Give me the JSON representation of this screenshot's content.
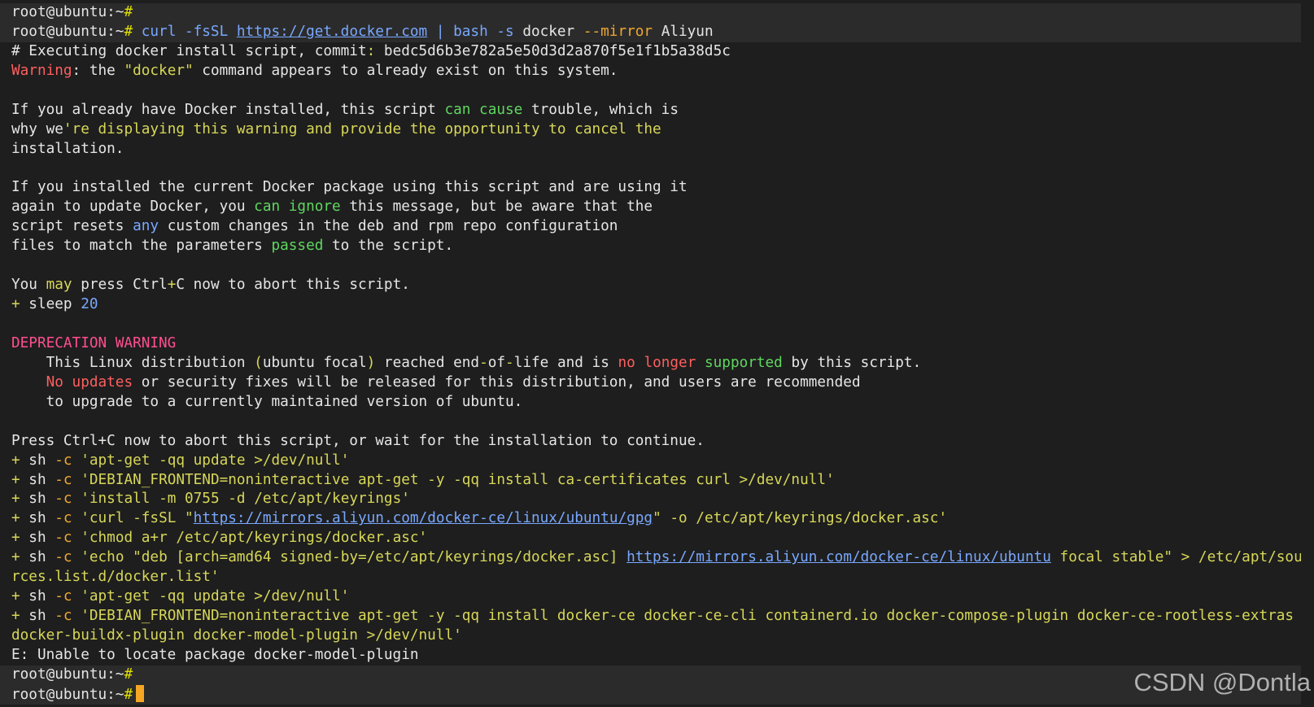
{
  "colors": {
    "default": "#e6e6e6",
    "prompt_hash": "#e0e000",
    "yellow": "#d7d759",
    "blue": "#79a8ff",
    "red": "#ff5f5f",
    "orange": "#f0a830",
    "green": "#5fd75f",
    "magenta": "#ff4f8f",
    "cursor": "#f5a623"
  },
  "watermark": "CSDN @Dontla",
  "lines": [
    {
      "hl": true,
      "segs": [
        {
          "t": "root@ubuntu:~",
          "c": "default"
        },
        {
          "t": "#",
          "c": "prompt_hash"
        }
      ]
    },
    {
      "hl": true,
      "segs": [
        {
          "t": "root@ubuntu:~",
          "c": "default"
        },
        {
          "t": "#",
          "c": "prompt_hash"
        },
        {
          "t": " curl -fsSL ",
          "c": "blue"
        },
        {
          "t": "https://get.docker.com",
          "c": "blue",
          "u": true
        },
        {
          "t": " | bash -s ",
          "c": "blue"
        },
        {
          "t": "docker ",
          "c": "default"
        },
        {
          "t": "--mirror",
          "c": "orange"
        },
        {
          "t": " Aliyun",
          "c": "default"
        }
      ]
    },
    {
      "segs": [
        {
          "t": "# Executing docker install script, commit",
          "c": "default"
        },
        {
          "t": ":",
          "c": "yellow"
        },
        {
          "t": " bedc5d6b3e782a5e50d3d2a870f5e1f1b5a38d5c",
          "c": "default"
        }
      ]
    },
    {
      "segs": [
        {
          "t": "Warning",
          "c": "red"
        },
        {
          "t": ": the ",
          "c": "default"
        },
        {
          "t": "\"docker\"",
          "c": "yellow"
        },
        {
          "t": " command appears to already exist on this system.",
          "c": "default"
        }
      ]
    },
    {
      "segs": [
        {
          "t": "",
          "c": "default"
        }
      ]
    },
    {
      "segs": [
        {
          "t": "If you already have Docker installed, this script ",
          "c": "default"
        },
        {
          "t": "can cause",
          "c": "green"
        },
        {
          "t": " trouble, which is",
          "c": "default"
        }
      ]
    },
    {
      "segs": [
        {
          "t": "why we",
          "c": "default"
        },
        {
          "t": "'re displaying this warning and provide the opportunity to cancel the",
          "c": "yellow"
        }
      ]
    },
    {
      "segs": [
        {
          "t": "installation.",
          "c": "default"
        }
      ]
    },
    {
      "segs": [
        {
          "t": "",
          "c": "default"
        }
      ]
    },
    {
      "segs": [
        {
          "t": "If you installed the current Docker package using this script and are using it",
          "c": "default"
        }
      ]
    },
    {
      "segs": [
        {
          "t": "again to update Docker, you ",
          "c": "default"
        },
        {
          "t": "can ignore",
          "c": "green"
        },
        {
          "t": " this message, but be aware that the",
          "c": "default"
        }
      ]
    },
    {
      "segs": [
        {
          "t": "script resets ",
          "c": "default"
        },
        {
          "t": "any",
          "c": "blue"
        },
        {
          "t": " custom changes in the deb and rpm repo configuration",
          "c": "default"
        }
      ]
    },
    {
      "segs": [
        {
          "t": "files to match the parameters ",
          "c": "default"
        },
        {
          "t": "passed",
          "c": "green"
        },
        {
          "t": " to the script.",
          "c": "default"
        }
      ]
    },
    {
      "segs": [
        {
          "t": "",
          "c": "default"
        }
      ]
    },
    {
      "segs": [
        {
          "t": "You ",
          "c": "default"
        },
        {
          "t": "may",
          "c": "yellow"
        },
        {
          "t": " press Ctrl",
          "c": "default"
        },
        {
          "t": "+",
          "c": "yellow"
        },
        {
          "t": "C now to abort this script.",
          "c": "default"
        }
      ]
    },
    {
      "segs": [
        {
          "t": "+",
          "c": "yellow"
        },
        {
          "t": " sleep ",
          "c": "default"
        },
        {
          "t": "20",
          "c": "blue"
        }
      ]
    },
    {
      "segs": [
        {
          "t": "",
          "c": "default"
        }
      ]
    },
    {
      "segs": [
        {
          "t": "DEPRECATION WARNING",
          "c": "magenta"
        }
      ]
    },
    {
      "segs": [
        {
          "t": "    This Linux distribution ",
          "c": "default"
        },
        {
          "t": "(",
          "c": "yellow"
        },
        {
          "t": "ubuntu focal",
          "c": "default"
        },
        {
          "t": ")",
          "c": "yellow"
        },
        {
          "t": " reached end",
          "c": "default"
        },
        {
          "t": "-",
          "c": "yellow"
        },
        {
          "t": "of",
          "c": "default"
        },
        {
          "t": "-",
          "c": "yellow"
        },
        {
          "t": "life and is ",
          "c": "default"
        },
        {
          "t": "no longer",
          "c": "red"
        },
        {
          "t": " supported",
          "c": "green"
        },
        {
          "t": " by this script.",
          "c": "default"
        }
      ]
    },
    {
      "segs": [
        {
          "t": "    ",
          "c": "default"
        },
        {
          "t": "No updates",
          "c": "red"
        },
        {
          "t": " or security fixes will be released for this distribution, and users are recommended",
          "c": "default"
        }
      ]
    },
    {
      "segs": [
        {
          "t": "    to upgrade to a currently maintained version of ubuntu.",
          "c": "default"
        }
      ]
    },
    {
      "segs": [
        {
          "t": "",
          "c": "default"
        }
      ]
    },
    {
      "segs": [
        {
          "t": "Press Ctrl+C now to abort this script, or wait for the installation to continue.",
          "c": "default"
        }
      ]
    },
    {
      "segs": [
        {
          "t": "+",
          "c": "yellow"
        },
        {
          "t": " sh ",
          "c": "default"
        },
        {
          "t": "-c",
          "c": "orange"
        },
        {
          "t": " 'apt-get -qq update >/dev/null'",
          "c": "yellow"
        }
      ]
    },
    {
      "segs": [
        {
          "t": "+",
          "c": "yellow"
        },
        {
          "t": " sh ",
          "c": "default"
        },
        {
          "t": "-c",
          "c": "orange"
        },
        {
          "t": " 'DEBIAN_FRONTEND=noninteractive apt-get -y -qq install ca-certificates curl >/dev/null'",
          "c": "yellow"
        }
      ]
    },
    {
      "segs": [
        {
          "t": "+",
          "c": "yellow"
        },
        {
          "t": " sh ",
          "c": "default"
        },
        {
          "t": "-c",
          "c": "orange"
        },
        {
          "t": " 'install -m 0755 -d /etc/apt/keyrings'",
          "c": "yellow"
        }
      ]
    },
    {
      "segs": [
        {
          "t": "+",
          "c": "yellow"
        },
        {
          "t": " sh ",
          "c": "default"
        },
        {
          "t": "-c",
          "c": "orange"
        },
        {
          "t": " 'curl -fsSL \"",
          "c": "yellow"
        },
        {
          "t": "https://mirrors.aliyun.com/docker-ce/linux/ubuntu/gpg",
          "c": "blue",
          "u": true
        },
        {
          "t": "\" -o /etc/apt/keyrings/docker.asc'",
          "c": "yellow"
        }
      ]
    },
    {
      "segs": [
        {
          "t": "+",
          "c": "yellow"
        },
        {
          "t": " sh ",
          "c": "default"
        },
        {
          "t": "-c",
          "c": "orange"
        },
        {
          "t": " 'chmod a+r /etc/apt/keyrings/docker.asc'",
          "c": "yellow"
        }
      ]
    },
    {
      "segs": [
        {
          "t": "+",
          "c": "yellow"
        },
        {
          "t": " sh ",
          "c": "default"
        },
        {
          "t": "-c",
          "c": "orange"
        },
        {
          "t": " 'echo \"deb [arch=amd64 signed-by=/etc/apt/keyrings/docker.asc] ",
          "c": "yellow"
        },
        {
          "t": "https://mirrors.aliyun.com/docker-ce/linux/ubuntu",
          "c": "blue",
          "u": true
        },
        {
          "t": " focal stable\" > /etc/apt/sou",
          "c": "yellow"
        },
        {
          "t": "⤶",
          "c": "blue"
        }
      ]
    },
    {
      "segs": [
        {
          "t": "rces.list.d/docker.list'",
          "c": "yellow"
        }
      ]
    },
    {
      "segs": [
        {
          "t": "+",
          "c": "yellow"
        },
        {
          "t": " sh ",
          "c": "default"
        },
        {
          "t": "-c",
          "c": "orange"
        },
        {
          "t": " 'apt-get -qq update >/dev/null'",
          "c": "yellow"
        }
      ]
    },
    {
      "segs": [
        {
          "t": "+",
          "c": "yellow"
        },
        {
          "t": " sh ",
          "c": "default"
        },
        {
          "t": "-c",
          "c": "orange"
        },
        {
          "t": " 'DEBIAN_FRONTEND=noninteractive apt-get -y -qq install docker-ce docker-ce-cli containerd.io docker-compose-plugin docker-ce-rootless-extras ",
          "c": "yellow"
        },
        {
          "t": "⤶",
          "c": "blue"
        }
      ]
    },
    {
      "segs": [
        {
          "t": "docker-buildx-plugin docker-model-plugin >/dev/null'",
          "c": "yellow"
        }
      ]
    },
    {
      "segs": [
        {
          "t": "E: Unable to locate package docker-model-plugin",
          "c": "default"
        }
      ]
    },
    {
      "hl": true,
      "segs": [
        {
          "t": "root@ubuntu:~",
          "c": "default"
        },
        {
          "t": "#",
          "c": "prompt_hash"
        }
      ]
    },
    {
      "hl": true,
      "cursor": true,
      "segs": [
        {
          "t": "root@ubuntu:~",
          "c": "default"
        },
        {
          "t": "#",
          "c": "prompt_hash"
        }
      ]
    }
  ]
}
